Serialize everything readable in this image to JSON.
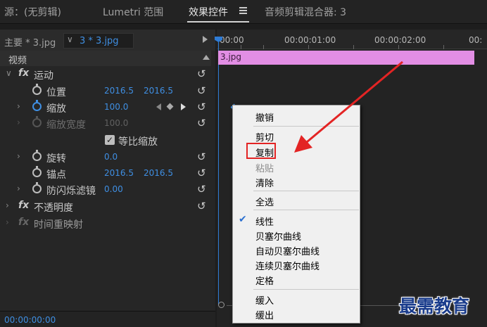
{
  "tabs": [
    {
      "label": "源：(无剪辑)"
    },
    {
      "label": "Lumetri 范围"
    },
    {
      "label": "效果控件"
    },
    {
      "label": "音频剪辑混合器: 3"
    }
  ],
  "clip_header": {
    "master": "主要 * 3.jpg",
    "selected": "3 * 3.jpg"
  },
  "section": "视频",
  "effects": {
    "motion": "运动",
    "position": {
      "label": "位置",
      "x": "2016.5",
      "y": "2016.5"
    },
    "scale": {
      "label": "缩放",
      "value": "100.0"
    },
    "scale_width": {
      "label": "缩放宽度",
      "value": "100.0"
    },
    "uniform": {
      "label": "等比缩放",
      "checked": true
    },
    "rotation": {
      "label": "旋转",
      "value": "0.0"
    },
    "anchor": {
      "label": "锚点",
      "x": "2016.5",
      "y": "2016.5"
    },
    "flicker": {
      "label": "防闪烁滤镜",
      "value": "0.00"
    },
    "opacity": "不透明度",
    "time_remap": "时间重映射"
  },
  "timecode": "00:00:00:00",
  "timeline": {
    "ticks": [
      "00:00",
      "00:00:01:00",
      "00:00:02:00",
      "00:"
    ],
    "clip_label": "3.jpg"
  },
  "context_menu": {
    "undo": "撤销",
    "cut": "剪切",
    "copy": "复制",
    "paste": "粘贴",
    "clear": "清除",
    "select_all": "全选",
    "linear": "线性",
    "bezier": "贝塞尔曲线",
    "auto_bezier": "自动贝塞尔曲线",
    "continuous_bezier": "连续贝塞尔曲线",
    "hold": "定格",
    "ease_in": "缓入",
    "ease_out": "缓出"
  },
  "watermark": "最需教育",
  "colors": {
    "accent_blue": "#3f8fe3",
    "clip_pink": "#e28ee4",
    "highlight_red": "#e32424"
  }
}
